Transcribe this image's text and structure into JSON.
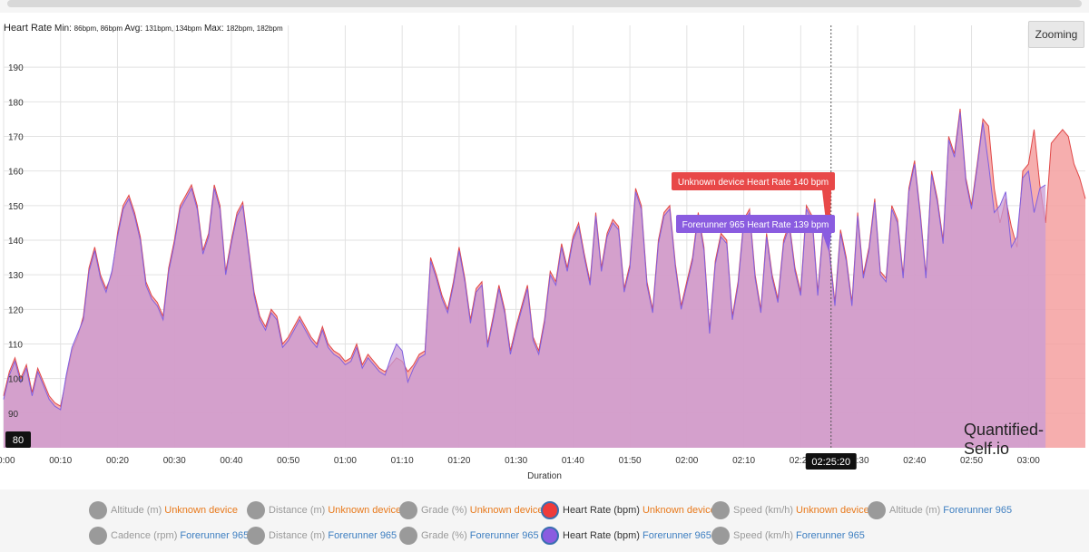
{
  "stats": {
    "title": "Heart Rate",
    "min_label": "Min:",
    "min_values": "86bpm, 86bpm",
    "avg_label": "Avg:",
    "avg_values": "131bpm, 134bpm",
    "max_label": "Max:",
    "max_values": "182bpm, 182bpm"
  },
  "zoom_button": "Zooming",
  "watermark": "Quantified-Self.io",
  "crosshair": {
    "x_label": "02:25:20",
    "y_label": "80"
  },
  "tooltips": [
    {
      "text": "Unknown device Heart Rate 140 bpm",
      "color": "#e84848"
    },
    {
      "text": "Forerunner 965 Heart Rate 139 bpm",
      "color": "#8a5ce0"
    }
  ],
  "legend": [
    {
      "metric": "Altitude (m)",
      "device": "Unknown device",
      "active": false
    },
    {
      "metric": "Distance (m)",
      "device": "Unknown device",
      "active": false
    },
    {
      "metric": "Grade (%)",
      "device": "Unknown device",
      "active": false
    },
    {
      "metric": "Heart Rate (bpm)",
      "device": "Unknown device",
      "active": true,
      "color": "#ee3b3b"
    },
    {
      "metric": "Speed (km/h)",
      "device": "Unknown device",
      "active": false
    },
    {
      "metric": "Altitude (m)",
      "device": "Forerunner 965",
      "active": false
    },
    {
      "metric": "Cadence (rpm)",
      "device": "Forerunner 965",
      "active": false
    },
    {
      "metric": "Distance (m)",
      "device": "Forerunner 965",
      "active": false
    },
    {
      "metric": "Grade (%)",
      "device": "Forerunner 965",
      "active": false
    },
    {
      "metric": "Heart Rate (bpm)",
      "device": "Forerunner 965",
      "active": true,
      "color": "#8a5ce0"
    },
    {
      "metric": "Speed (km/h)",
      "device": "Forerunner 965",
      "active": false
    }
  ],
  "colors": {
    "unknown_device": "#e8791b",
    "forerunner": "#3e7fc1",
    "series_unknown_line": "#e04848",
    "series_unknown_fill": "#f4a0a0",
    "series_forerunner_line": "#8060e0",
    "series_forerunner_fill": "#c89bd6"
  },
  "chart_data": {
    "type": "area",
    "xlabel": "Duration",
    "ylabel": "",
    "x_unit": "minutes",
    "xlim": [
      0,
      190
    ],
    "ylim": [
      80,
      200
    ],
    "x_ticks": [
      "00:00",
      "00:10",
      "00:20",
      "00:30",
      "00:40",
      "00:50",
      "01:00",
      "01:10",
      "01:20",
      "01:30",
      "01:40",
      "01:50",
      "02:00",
      "02:10",
      "02:20",
      "02:30",
      "02:40",
      "02:50",
      "03:00"
    ],
    "x_tick_values": [
      0,
      10,
      20,
      30,
      40,
      50,
      60,
      70,
      80,
      90,
      100,
      110,
      120,
      130,
      140,
      150,
      160,
      170,
      180
    ],
    "y_ticks": [
      90,
      100,
      110,
      120,
      130,
      140,
      150,
      160,
      170,
      180,
      190
    ],
    "crosshair_x": 145.33,
    "series": [
      {
        "name": "Heart Rate (bpm) Unknown device",
        "x": [
          0,
          1,
          2,
          3,
          4,
          5,
          6,
          7,
          8,
          9,
          10,
          11,
          12,
          13,
          14,
          15,
          16,
          17,
          18,
          19,
          20,
          21,
          22,
          23,
          24,
          25,
          26,
          27,
          28,
          29,
          30,
          31,
          32,
          33,
          34,
          35,
          36,
          37,
          38,
          39,
          40,
          41,
          42,
          43,
          44,
          45,
          46,
          47,
          48,
          49,
          50,
          51,
          52,
          53,
          54,
          55,
          56,
          57,
          58,
          59,
          60,
          61,
          62,
          63,
          64,
          65,
          66,
          67,
          68,
          69,
          70,
          71,
          72,
          73,
          74,
          75,
          76,
          77,
          78,
          79,
          80,
          81,
          82,
          83,
          84,
          85,
          86,
          87,
          88,
          89,
          90,
          91,
          92,
          93,
          94,
          95,
          96,
          97,
          98,
          99,
          100,
          101,
          102,
          103,
          104,
          105,
          106,
          107,
          108,
          109,
          110,
          111,
          112,
          113,
          114,
          115,
          116,
          117,
          118,
          119,
          120,
          121,
          122,
          123,
          124,
          125,
          126,
          127,
          128,
          129,
          130,
          131,
          132,
          133,
          134,
          135,
          136,
          137,
          138,
          139,
          140,
          141,
          142,
          143,
          144,
          145,
          146,
          147,
          148,
          149,
          150,
          151,
          152,
          153,
          154,
          155,
          156,
          157,
          158,
          159,
          160,
          161,
          162,
          163,
          164,
          165,
          166,
          167,
          168,
          169,
          170,
          171,
          172,
          173,
          174,
          175,
          176,
          177,
          178,
          179,
          180,
          181,
          182,
          183,
          184,
          185,
          186,
          187,
          188,
          189,
          190
        ],
        "values": [
          95,
          102,
          106,
          100,
          104,
          96,
          103,
          99,
          95,
          93,
          92,
          100,
          108,
          112,
          118,
          132,
          138,
          130,
          126,
          130,
          142,
          150,
          153,
          148,
          141,
          128,
          124,
          122,
          118,
          132,
          140,
          150,
          153,
          156,
          150,
          137,
          142,
          156,
          150,
          131,
          140,
          148,
          151,
          138,
          125,
          118,
          115,
          120,
          118,
          110,
          112,
          115,
          118,
          115,
          112,
          110,
          115,
          110,
          108,
          107,
          105,
          106,
          110,
          104,
          107,
          105,
          103,
          102,
          104,
          106,
          105,
          102,
          104,
          107,
          108,
          135,
          130,
          124,
          120,
          128,
          138,
          129,
          117,
          126,
          128,
          110,
          118,
          127,
          120,
          108,
          115,
          121,
          127,
          112,
          108,
          117,
          131,
          128,
          139,
          132,
          141,
          145,
          136,
          128,
          148,
          132,
          142,
          146,
          144,
          126,
          133,
          155,
          150,
          128,
          120,
          140,
          148,
          150,
          133,
          121,
          128,
          135,
          148,
          138,
          114,
          134,
          142,
          140,
          118,
          128,
          146,
          149,
          130,
          120,
          142,
          130,
          123,
          140,
          145,
          132,
          125,
          150,
          147,
          125,
          145,
          138,
          122,
          143,
          135,
          122,
          148,
          130,
          138,
          152,
          131,
          129,
          150,
          146,
          130,
          155,
          163,
          148,
          130,
          160,
          152,
          140,
          170,
          165,
          178,
          158,
          150,
          162,
          175,
          173,
          155,
          145,
          152,
          144,
          138,
          160,
          162,
          172,
          156,
          145,
          168,
          170,
          172,
          170,
          162,
          158,
          152
        ],
        "line_color": "#e04848",
        "fill_color": "#f4a0a0"
      },
      {
        "name": "Heart Rate (bpm) Forerunner 965",
        "x": [
          0,
          1,
          2,
          3,
          4,
          5,
          6,
          7,
          8,
          9,
          10,
          11,
          12,
          13,
          14,
          15,
          16,
          17,
          18,
          19,
          20,
          21,
          22,
          23,
          24,
          25,
          26,
          27,
          28,
          29,
          30,
          31,
          32,
          33,
          34,
          35,
          36,
          37,
          38,
          39,
          40,
          41,
          42,
          43,
          44,
          45,
          46,
          47,
          48,
          49,
          50,
          51,
          52,
          53,
          54,
          55,
          56,
          57,
          58,
          59,
          60,
          61,
          62,
          63,
          64,
          65,
          66,
          67,
          68,
          69,
          70,
          71,
          72,
          73,
          74,
          75,
          76,
          77,
          78,
          79,
          80,
          81,
          82,
          83,
          84,
          85,
          86,
          87,
          88,
          89,
          90,
          91,
          92,
          93,
          94,
          95,
          96,
          97,
          98,
          99,
          100,
          101,
          102,
          103,
          104,
          105,
          106,
          107,
          108,
          109,
          110,
          111,
          112,
          113,
          114,
          115,
          116,
          117,
          118,
          119,
          120,
          121,
          122,
          123,
          124,
          125,
          126,
          127,
          128,
          129,
          130,
          131,
          132,
          133,
          134,
          135,
          136,
          137,
          138,
          139,
          140,
          141,
          142,
          143,
          144,
          145,
          146,
          147,
          148,
          149,
          150,
          151,
          152,
          153,
          154,
          155,
          156,
          157,
          158,
          159,
          160,
          161,
          162,
          163,
          164,
          165,
          166,
          167,
          168,
          169,
          170,
          171,
          172,
          173,
          174,
          175,
          176,
          177,
          178,
          179,
          180,
          181,
          182,
          183
        ],
        "values": [
          94,
          101,
          105,
          99,
          103,
          95,
          102,
          98,
          94,
          92,
          91,
          101,
          109,
          113,
          117,
          131,
          137,
          129,
          125,
          131,
          141,
          149,
          152,
          147,
          140,
          127,
          123,
          121,
          117,
          131,
          139,
          149,
          152,
          155,
          149,
          136,
          141,
          155,
          149,
          130,
          139,
          147,
          150,
          137,
          124,
          117,
          114,
          119,
          117,
          109,
          111,
          114,
          117,
          114,
          111,
          109,
          114,
          109,
          107,
          106,
          104,
          105,
          109,
          103,
          106,
          104,
          102,
          101,
          106,
          110,
          108,
          99,
          103,
          106,
          107,
          134,
          129,
          123,
          119,
          127,
          137,
          128,
          116,
          125,
          127,
          109,
          117,
          126,
          119,
          107,
          114,
          120,
          126,
          111,
          107,
          116,
          130,
          127,
          138,
          131,
          140,
          144,
          135,
          127,
          147,
          131,
          141,
          145,
          143,
          125,
          132,
          154,
          149,
          127,
          119,
          139,
          147,
          149,
          132,
          120,
          127,
          134,
          147,
          137,
          113,
          133,
          141,
          139,
          117,
          127,
          145,
          148,
          129,
          119,
          141,
          129,
          122,
          139,
          144,
          131,
          124,
          149,
          146,
          124,
          144,
          137,
          121,
          142,
          134,
          121,
          147,
          129,
          137,
          151,
          130,
          128,
          149,
          145,
          129,
          154,
          162,
          147,
          129,
          159,
          151,
          139,
          169,
          164,
          177,
          157,
          149,
          161,
          174,
          162,
          148,
          150,
          154,
          138,
          141,
          158,
          160,
          148,
          155,
          156
        ],
        "line_color": "#8060e0",
        "fill_color": "#c89bd6"
      }
    ]
  }
}
